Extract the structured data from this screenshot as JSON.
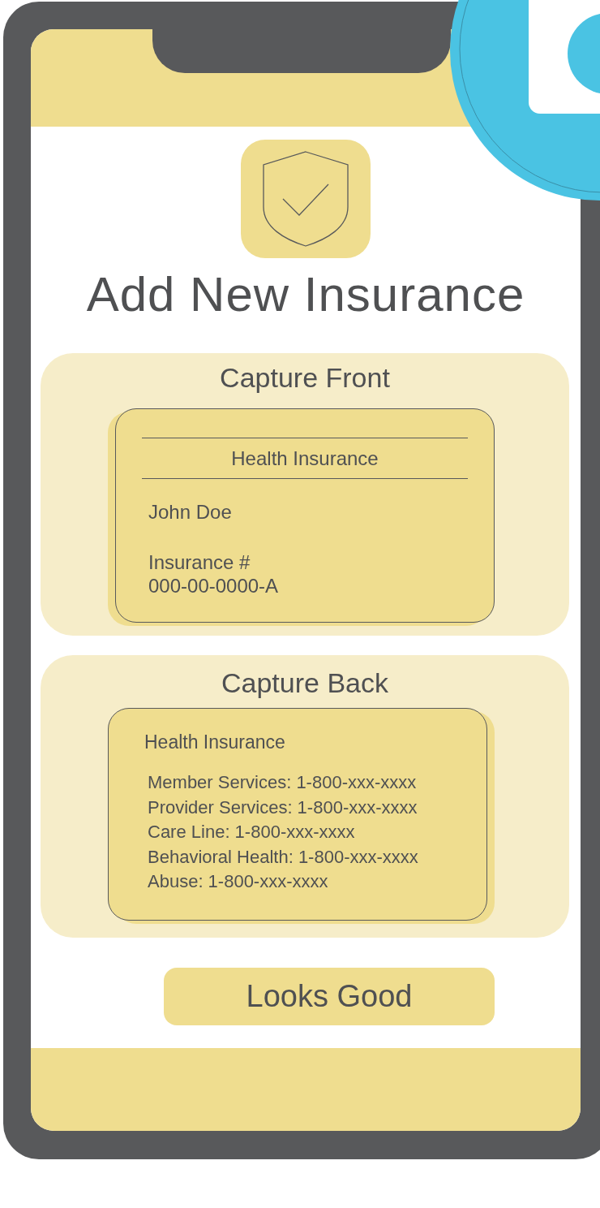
{
  "screen": {
    "title": "Add New Insurance",
    "front": {
      "heading": "Capture Front",
      "card_title": "Health Insurance",
      "holder_name": "John Doe",
      "number_label": "Insurance #",
      "number": "000-00-0000-A"
    },
    "back": {
      "heading": "Capture Back",
      "card_title": "Health Insurance",
      "lines": [
        "Member Services: 1-800-xxx-xxxx",
        "Provider Services: 1-800-xxx-xxxx",
        "Care Line: 1-800-xxx-xxxx",
        "Behavioral Health: 1-800-xxx-xxxx",
        "Abuse: 1-800-xxx-xxxx"
      ]
    },
    "button": "Looks Good"
  }
}
